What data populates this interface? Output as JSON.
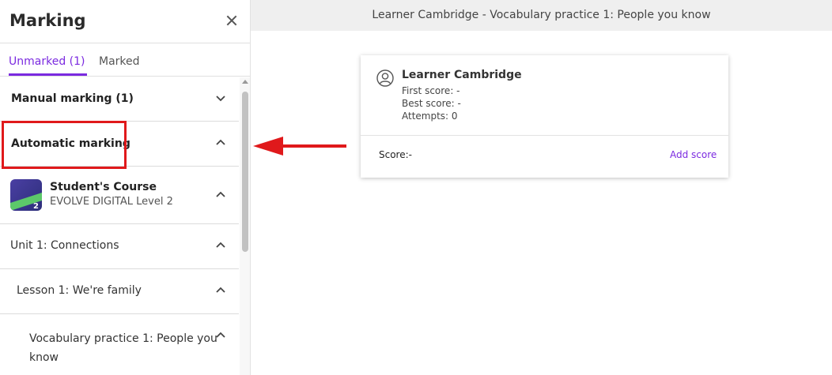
{
  "sidebar": {
    "title": "Marking",
    "tabs": [
      {
        "label": "Unmarked (1)",
        "active": true
      },
      {
        "label": "Marked",
        "active": false
      }
    ],
    "sections": {
      "manual": "Manual marking (1)",
      "automatic": "Automatic marking"
    },
    "course": {
      "title": "Student's Course",
      "subtitle": "EVOLVE DIGITAL Level 2",
      "icon_number": "2"
    },
    "tree": {
      "unit": "Unit 1: Connections",
      "lesson": "Lesson 1: We're family",
      "activity_line1": "Vocabulary practice 1: People you",
      "activity_line2": "know"
    }
  },
  "main": {
    "title": "Learner Cambridge - Vocabulary practice 1: People you know",
    "learner": {
      "name": "Learner Cambridge",
      "first_score": "First score: -",
      "best_score": "Best score: -",
      "attempts": "Attempts: 0"
    },
    "score_label": "Score:-",
    "add_score_label": "Add score"
  },
  "colors": {
    "accent": "#7b2ae0",
    "annotation": "#e0191b"
  }
}
